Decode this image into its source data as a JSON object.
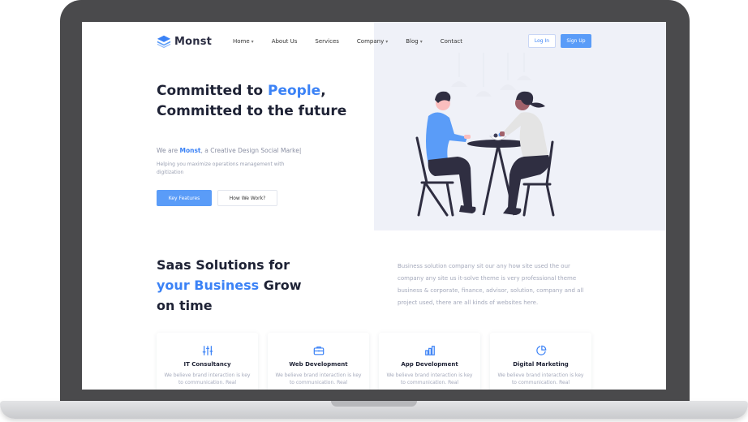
{
  "brand": {
    "name": "Monst",
    "accent": "#3b82f6"
  },
  "nav": {
    "items": [
      {
        "label": "Home",
        "has_dropdown": true
      },
      {
        "label": "About Us",
        "has_dropdown": false
      },
      {
        "label": "Services",
        "has_dropdown": false
      },
      {
        "label": "Company",
        "has_dropdown": true
      },
      {
        "label": "Blog",
        "has_dropdown": true
      },
      {
        "label": "Contact",
        "has_dropdown": false
      }
    ],
    "login_label": "Log In",
    "signup_label": "Sign Up"
  },
  "hero": {
    "title_part1": "Committed to ",
    "title_accent": "People",
    "title_part2": ", Committed to the future",
    "tagline_prefix": "We are ",
    "tagline_brand": "Monst",
    "tagline_suffix": ", a Creative Design Social Marke|",
    "description": "Helping you maximize operations management with digitization",
    "primary_button": "Key Features",
    "secondary_button": "How We Work?"
  },
  "solutions": {
    "title_part1": "Saas Solutions for ",
    "title_accent": "your Business",
    "title_part2": " Grow on time",
    "description": "Business solution company sit our any how site used the our company any site us it-solve theme is very professional theme business & corporate, finance, advisor, solution, company and all project used, there are all kinds of websites here."
  },
  "cards": [
    {
      "icon": "sliders-icon",
      "title": "IT Consultancy",
      "text": "We believe brand interaction is key to communication. Real"
    },
    {
      "icon": "briefcase-icon",
      "title": "Web Development",
      "text": "We believe brand interaction is key to communication. Real"
    },
    {
      "icon": "bar-chart-icon",
      "title": "App Development",
      "text": "We believe brand interaction is key to communication. Real"
    },
    {
      "icon": "pie-chart-icon",
      "title": "Digital Marketing",
      "text": "We believe brand interaction is key to communication. Real"
    }
  ]
}
